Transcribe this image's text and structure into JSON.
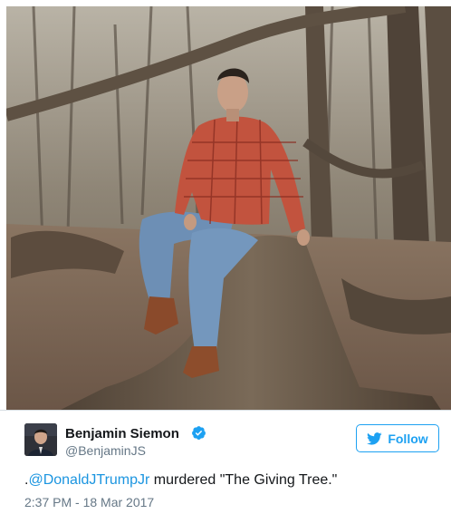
{
  "tweet": {
    "author": {
      "name": "Benjamin Siemon",
      "handle": "@BenjaminJS",
      "verified": true
    },
    "follow_label": "Follow",
    "text_prefix": ".",
    "mention": "@DonaldJTrumpJr",
    "text_rest": " murdered \"The Giving Tree.\"",
    "timestamp": "2:37 PM - 18 Mar 2017"
  },
  "icons": {
    "verified": "verified-badge-icon",
    "follow": "twitter-bird-icon"
  },
  "colors": {
    "accent": "#1da1f2",
    "mention": "#1b95e0",
    "secondary_text": "#657786",
    "primary_text": "#14171a"
  }
}
